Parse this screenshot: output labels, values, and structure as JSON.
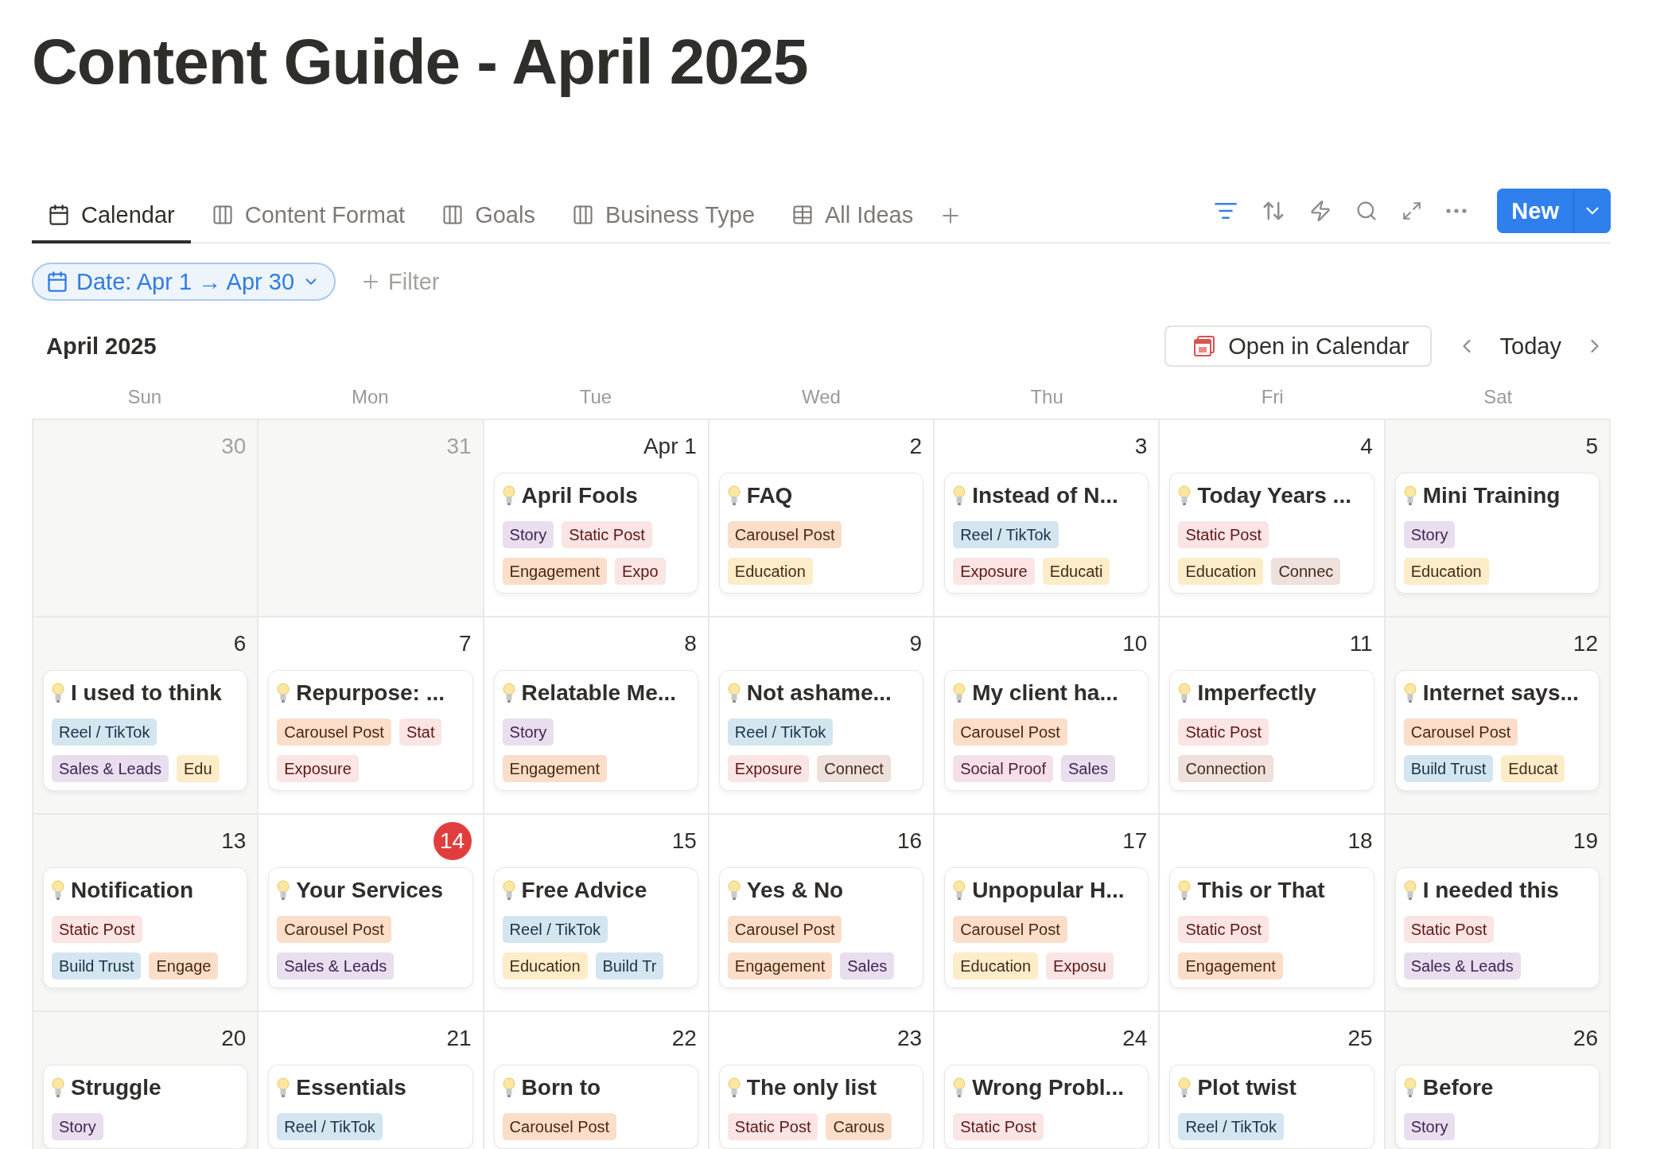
{
  "page_title": "Content Guide - April 2025",
  "tabs": [
    {
      "label": "Calendar",
      "kind": "calendar",
      "selected": true
    },
    {
      "label": "Content Format",
      "kind": "board",
      "selected": false
    },
    {
      "label": "Goals",
      "kind": "board",
      "selected": false
    },
    {
      "label": "Business Type",
      "kind": "board",
      "selected": false
    },
    {
      "label": "All Ideas",
      "kind": "table",
      "selected": false
    }
  ],
  "toolbar": {
    "filter_active": true,
    "new_button": "New"
  },
  "filter_chip": "Date: Apr 1 → Apr 30",
  "add_filter": "Filter",
  "month": "April 2025",
  "open_in_calendar": "Open in Calendar",
  "today_button": "Today",
  "weekdays": [
    "Sun",
    "Mon",
    "Tue",
    "Wed",
    "Thu",
    "Fri",
    "Sat"
  ],
  "weeks": [
    [
      {
        "date": "30",
        "outside_month": true,
        "today": false
      },
      {
        "date": "31",
        "outside_month": true,
        "today": false
      },
      {
        "date": "Apr 1",
        "outside_month": false,
        "today": false,
        "card": {
          "title": "April Fools",
          "tag_rows": [
            [
              {
                "label": "Story",
                "color": "#e8deee"
              },
              {
                "label": "Static Post",
                "color": "#fbe4e4"
              }
            ],
            [
              {
                "label": "Engagement",
                "color": "#fadec9"
              },
              {
                "label": "Expo",
                "color": "#fbe4e4"
              }
            ]
          ]
        }
      },
      {
        "date": "2",
        "outside_month": false,
        "today": false,
        "card": {
          "title": "FAQ",
          "tag_rows": [
            [
              {
                "label": "Carousel Post",
                "color": "#fadec9"
              }
            ],
            [
              {
                "label": "Education",
                "color": "#fdecc8"
              }
            ]
          ]
        }
      },
      {
        "date": "3",
        "outside_month": false,
        "today": false,
        "card": {
          "title": "Instead of N...",
          "tag_rows": [
            [
              {
                "label": "Reel / TikTok",
                "color": "#d3e5ef"
              }
            ],
            [
              {
                "label": "Exposure",
                "color": "#fbe4e4"
              },
              {
                "label": "Educati",
                "color": "#fdecc8"
              }
            ]
          ]
        }
      },
      {
        "date": "4",
        "outside_month": false,
        "today": false,
        "card": {
          "title": "Today Years ...",
          "tag_rows": [
            [
              {
                "label": "Static Post",
                "color": "#fbe4e4"
              }
            ],
            [
              {
                "label": "Education",
                "color": "#fdecc8"
              },
              {
                "label": "Connec",
                "color": "#eee0da"
              }
            ]
          ]
        }
      },
      {
        "date": "5",
        "outside_month": false,
        "today": false,
        "card": {
          "title": "Mini Training",
          "tag_rows": [
            [
              {
                "label": "Story",
                "color": "#e8deee"
              }
            ],
            [
              {
                "label": "Education",
                "color": "#fdecc8"
              }
            ]
          ]
        }
      }
    ],
    [
      {
        "date": "6",
        "outside_month": false,
        "today": false,
        "card": {
          "title": "I used to think",
          "tag_rows": [
            [
              {
                "label": "Reel / TikTok",
                "color": "#d3e5ef"
              }
            ],
            [
              {
                "label": "Sales & Leads",
                "color": "#e8deee"
              },
              {
                "label": "Edu",
                "color": "#fdecc8"
              }
            ]
          ]
        }
      },
      {
        "date": "7",
        "outside_month": false,
        "today": false,
        "card": {
          "title": "Repurpose: ...",
          "tag_rows": [
            [
              {
                "label": "Carousel Post",
                "color": "#fadec9"
              },
              {
                "label": "Stat",
                "color": "#fbe4e4"
              }
            ],
            [
              {
                "label": "Exposure",
                "color": "#fbe4e4"
              }
            ]
          ]
        }
      },
      {
        "date": "8",
        "outside_month": false,
        "today": false,
        "card": {
          "title": "Relatable Me...",
          "tag_rows": [
            [
              {
                "label": "Story",
                "color": "#e8deee"
              }
            ],
            [
              {
                "label": "Engagement",
                "color": "#fadec9"
              }
            ]
          ]
        }
      },
      {
        "date": "9",
        "outside_month": false,
        "today": false,
        "card": {
          "title": "Not ashame...",
          "tag_rows": [
            [
              {
                "label": "Reel / TikTok",
                "color": "#d3e5ef"
              }
            ],
            [
              {
                "label": "Exposure",
                "color": "#fbe4e4"
              },
              {
                "label": "Connect",
                "color": "#eee0da"
              }
            ]
          ]
        }
      },
      {
        "date": "10",
        "outside_month": false,
        "today": false,
        "card": {
          "title": "My client ha...",
          "tag_rows": [
            [
              {
                "label": "Carousel Post",
                "color": "#fadec9"
              }
            ],
            [
              {
                "label": "Social Proof",
                "color": "#f5e0e9"
              },
              {
                "label": "Sales",
                "color": "#e8deee"
              }
            ]
          ]
        }
      },
      {
        "date": "11",
        "outside_month": false,
        "today": false,
        "card": {
          "title": "Imperfectly",
          "tag_rows": [
            [
              {
                "label": "Static Post",
                "color": "#fbe4e4"
              }
            ],
            [
              {
                "label": "Connection",
                "color": "#eee0da"
              }
            ]
          ]
        }
      },
      {
        "date": "12",
        "outside_month": false,
        "today": false,
        "card": {
          "title": "Internet says...",
          "tag_rows": [
            [
              {
                "label": "Carousel Post",
                "color": "#fadec9"
              }
            ],
            [
              {
                "label": "Build Trust",
                "color": "#d3e5ef"
              },
              {
                "label": "Educat",
                "color": "#fdecc8"
              }
            ]
          ]
        }
      }
    ],
    [
      {
        "date": "13",
        "outside_month": false,
        "today": false,
        "card": {
          "title": "Notification",
          "tag_rows": [
            [
              {
                "label": "Static Post",
                "color": "#fbe4e4"
              }
            ],
            [
              {
                "label": "Build Trust",
                "color": "#d3e5ef"
              },
              {
                "label": "Engage",
                "color": "#fadec9"
              }
            ]
          ]
        }
      },
      {
        "date": "14",
        "outside_month": false,
        "today": true,
        "card": {
          "title": "Your Services",
          "tag_rows": [
            [
              {
                "label": "Carousel Post",
                "color": "#fadec9"
              }
            ],
            [
              {
                "label": "Sales & Leads",
                "color": "#e8deee"
              }
            ]
          ]
        }
      },
      {
        "date": "15",
        "outside_month": false,
        "today": false,
        "card": {
          "title": "Free Advice",
          "tag_rows": [
            [
              {
                "label": "Reel / TikTok",
                "color": "#d3e5ef"
              }
            ],
            [
              {
                "label": "Education",
                "color": "#fdecc8"
              },
              {
                "label": "Build Tr",
                "color": "#d3e5ef"
              }
            ]
          ]
        }
      },
      {
        "date": "16",
        "outside_month": false,
        "today": false,
        "card": {
          "title": "Yes & No",
          "tag_rows": [
            [
              {
                "label": "Carousel Post",
                "color": "#fadec9"
              }
            ],
            [
              {
                "label": "Engagement",
                "color": "#fadec9"
              },
              {
                "label": "Sales",
                "color": "#e8deee"
              }
            ]
          ]
        }
      },
      {
        "date": "17",
        "outside_month": false,
        "today": false,
        "card": {
          "title": "Unpopular H...",
          "tag_rows": [
            [
              {
                "label": "Carousel Post",
                "color": "#fadec9"
              }
            ],
            [
              {
                "label": "Education",
                "color": "#fdecc8"
              },
              {
                "label": "Exposu",
                "color": "#fbe4e4"
              }
            ]
          ]
        }
      },
      {
        "date": "18",
        "outside_month": false,
        "today": false,
        "card": {
          "title": "This or That",
          "tag_rows": [
            [
              {
                "label": "Static Post",
                "color": "#fbe4e4"
              }
            ],
            [
              {
                "label": "Engagement",
                "color": "#fadec9"
              }
            ]
          ]
        }
      },
      {
        "date": "19",
        "outside_month": false,
        "today": false,
        "card": {
          "title": "I needed this",
          "tag_rows": [
            [
              {
                "label": "Static Post",
                "color": "#fbe4e4"
              }
            ],
            [
              {
                "label": "Sales & Leads",
                "color": "#e8deee"
              }
            ]
          ]
        }
      }
    ],
    [
      {
        "date": "20",
        "outside_month": false,
        "today": false,
        "card": {
          "title": "Struggle",
          "tag_rows": [
            [
              {
                "label": "Story",
                "color": "#e8deee"
              }
            ]
          ]
        }
      },
      {
        "date": "21",
        "outside_month": false,
        "today": false,
        "card": {
          "title": "Essentials",
          "tag_rows": [
            [
              {
                "label": "Reel / TikTok",
                "color": "#d3e5ef"
              }
            ]
          ]
        }
      },
      {
        "date": "22",
        "outside_month": false,
        "today": false,
        "card": {
          "title": "Born to",
          "tag_rows": [
            [
              {
                "label": "Carousel Post",
                "color": "#fadec9"
              }
            ]
          ]
        }
      },
      {
        "date": "23",
        "outside_month": false,
        "today": false,
        "card": {
          "title": "The only list",
          "tag_rows": [
            [
              {
                "label": "Static Post",
                "color": "#fbe4e4"
              },
              {
                "label": "Carous",
                "color": "#fadec9"
              }
            ]
          ]
        }
      },
      {
        "date": "24",
        "outside_month": false,
        "today": false,
        "card": {
          "title": "Wrong Probl...",
          "tag_rows": [
            [
              {
                "label": "Static Post",
                "color": "#fbe4e4"
              }
            ]
          ]
        }
      },
      {
        "date": "25",
        "outside_month": false,
        "today": false,
        "card": {
          "title": "Plot twist",
          "tag_rows": [
            [
              {
                "label": "Reel / TikTok",
                "color": "#d3e5ef"
              }
            ]
          ]
        }
      },
      {
        "date": "26",
        "outside_month": false,
        "today": false,
        "card": {
          "title": "Before",
          "tag_rows": [
            [
              {
                "label": "Story",
                "color": "#e8deee"
              }
            ]
          ]
        }
      }
    ]
  ]
}
